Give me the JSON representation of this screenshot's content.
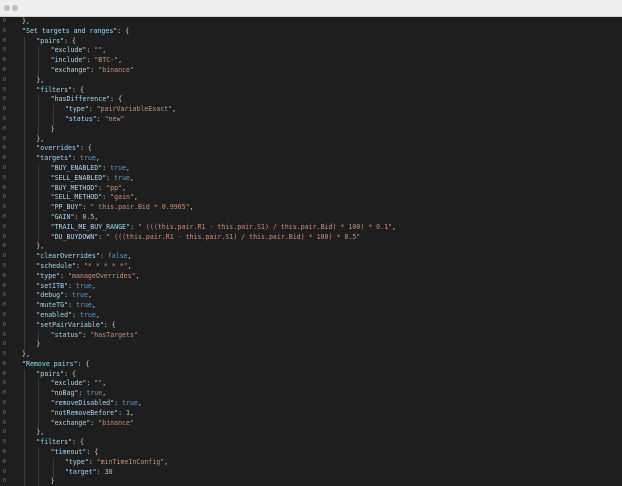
{
  "window": {
    "dots": [
      "close",
      "minimize"
    ]
  },
  "editor": {
    "lines": [
      {
        "no": "0",
        "indent": 1,
        "tokens": [
          {
            "t": "},",
            "c": "p"
          }
        ]
      },
      {
        "no": "0",
        "indent": 1,
        "tokens": [
          {
            "t": "\"Set targets and ranges\"",
            "c": "k"
          },
          {
            "t": ": {",
            "c": "p"
          }
        ]
      },
      {
        "no": "0",
        "indent": 2,
        "tokens": [
          {
            "t": "\"pairs\"",
            "c": "k"
          },
          {
            "t": ": {",
            "c": "p"
          }
        ]
      },
      {
        "no": "0",
        "indent": 3,
        "tokens": [
          {
            "t": "\"exclude\"",
            "c": "k"
          },
          {
            "t": ": ",
            "c": "p"
          },
          {
            "t": "\"\"",
            "c": "s"
          },
          {
            "t": ",",
            "c": "p"
          }
        ]
      },
      {
        "no": "0",
        "indent": 3,
        "tokens": [
          {
            "t": "\"include\"",
            "c": "k"
          },
          {
            "t": ": ",
            "c": "p"
          },
          {
            "t": "\"BTC-\"",
            "c": "s"
          },
          {
            "t": ",",
            "c": "p"
          }
        ]
      },
      {
        "no": "0",
        "indent": 3,
        "tokens": [
          {
            "t": "\"exchange\"",
            "c": "k"
          },
          {
            "t": ": ",
            "c": "p"
          },
          {
            "t": "\"binance\"",
            "c": "s"
          }
        ]
      },
      {
        "no": "0",
        "indent": 2,
        "tokens": [
          {
            "t": "},",
            "c": "p"
          }
        ]
      },
      {
        "no": "0",
        "indent": 2,
        "tokens": [
          {
            "t": "\"filters\"",
            "c": "k"
          },
          {
            "t": ": {",
            "c": "p"
          }
        ]
      },
      {
        "no": "0",
        "indent": 3,
        "tokens": [
          {
            "t": "\"hasDifference\"",
            "c": "k"
          },
          {
            "t": ": {",
            "c": "p"
          }
        ]
      },
      {
        "no": "0",
        "indent": 4,
        "tokens": [
          {
            "t": "\"type\"",
            "c": "k"
          },
          {
            "t": ": ",
            "c": "p"
          },
          {
            "t": "\"pairVariableExact\"",
            "c": "s"
          },
          {
            "t": ",",
            "c": "p"
          }
        ]
      },
      {
        "no": "0",
        "indent": 4,
        "tokens": [
          {
            "t": "\"status\"",
            "c": "k"
          },
          {
            "t": ": ",
            "c": "p"
          },
          {
            "t": "\"new\"",
            "c": "s"
          }
        ]
      },
      {
        "no": "0",
        "indent": 3,
        "tokens": [
          {
            "t": "}",
            "c": "p"
          }
        ]
      },
      {
        "no": "0",
        "indent": 2,
        "tokens": [
          {
            "t": "},",
            "c": "p"
          }
        ]
      },
      {
        "no": "0",
        "indent": 2,
        "tokens": [
          {
            "t": "\"overrides\"",
            "c": "k"
          },
          {
            "t": ": {",
            "c": "p"
          }
        ]
      },
      {
        "no": "0",
        "indent": 2,
        "tokens": [
          {
            "t": "\"targets\"",
            "c": "k"
          },
          {
            "t": ": ",
            "c": "p"
          },
          {
            "t": "true",
            "c": "b"
          },
          {
            "t": ",",
            "c": "p"
          }
        ]
      },
      {
        "no": "0",
        "indent": 3,
        "tokens": [
          {
            "t": "\"BUY_ENABLED\"",
            "c": "k"
          },
          {
            "t": ": ",
            "c": "p"
          },
          {
            "t": "true",
            "c": "b"
          },
          {
            "t": ",",
            "c": "p"
          }
        ]
      },
      {
        "no": "0",
        "indent": 3,
        "tokens": [
          {
            "t": "\"SELL_ENABLED\"",
            "c": "k"
          },
          {
            "t": ": ",
            "c": "p"
          },
          {
            "t": "true",
            "c": "b"
          },
          {
            "t": ",",
            "c": "p"
          }
        ]
      },
      {
        "no": "0",
        "indent": 3,
        "tokens": [
          {
            "t": "\"BUY_METHOD\"",
            "c": "k"
          },
          {
            "t": ": ",
            "c": "p"
          },
          {
            "t": "\"pp\"",
            "c": "s"
          },
          {
            "t": ",",
            "c": "p"
          }
        ]
      },
      {
        "no": "0",
        "indent": 3,
        "tokens": [
          {
            "t": "\"SELL_METHOD\"",
            "c": "k"
          },
          {
            "t": ": ",
            "c": "p"
          },
          {
            "t": "\"gain\"",
            "c": "s"
          },
          {
            "t": ",",
            "c": "p"
          }
        ]
      },
      {
        "no": "0",
        "indent": 3,
        "tokens": [
          {
            "t": "\"PP_BUY\"",
            "c": "k"
          },
          {
            "t": ": ",
            "c": "p"
          },
          {
            "t": "\" this.pair.Bid * 0.9965\"",
            "c": "s"
          },
          {
            "t": ",",
            "c": "p"
          }
        ]
      },
      {
        "no": "0",
        "indent": 3,
        "tokens": [
          {
            "t": "\"GAIN\"",
            "c": "k"
          },
          {
            "t": ": ",
            "c": "p"
          },
          {
            "t": "0.5",
            "c": "n"
          },
          {
            "t": ",",
            "c": "p"
          }
        ]
      },
      {
        "no": "0",
        "indent": 3,
        "tokens": [
          {
            "t": "\"TRAIL_ME_BUY_RANGE\"",
            "c": "k"
          },
          {
            "t": ": ",
            "c": "p"
          },
          {
            "t": "\" (((this.pair.R1 - this.pair.S1) / this.pair.Bid) * 100) * 0.1\"",
            "c": "s"
          },
          {
            "t": ",",
            "c": "p"
          }
        ]
      },
      {
        "no": "0",
        "indent": 3,
        "tokens": [
          {
            "t": "\"DU_BUYDOWN\"",
            "c": "k"
          },
          {
            "t": ": ",
            "c": "p"
          },
          {
            "t": "\" (((this.pair.R1 - this.pair.S1) / this.pair.Bid) * 100) * 0.5\"",
            "c": "s"
          }
        ]
      },
      {
        "no": "0",
        "indent": 2,
        "tokens": [
          {
            "t": "},",
            "c": "p"
          }
        ]
      },
      {
        "no": "0",
        "indent": 2,
        "tokens": [
          {
            "t": "\"clearOverrides\"",
            "c": "k"
          },
          {
            "t": ": ",
            "c": "p"
          },
          {
            "t": "false",
            "c": "b"
          },
          {
            "t": ",",
            "c": "p"
          }
        ]
      },
      {
        "no": "0",
        "indent": 2,
        "tokens": [
          {
            "t": "\"schedule\"",
            "c": "k"
          },
          {
            "t": ": ",
            "c": "p"
          },
          {
            "t": "\"* * * * *\"",
            "c": "s"
          },
          {
            "t": ",",
            "c": "p"
          }
        ]
      },
      {
        "no": "0",
        "indent": 2,
        "tokens": [
          {
            "t": "\"type\"",
            "c": "k"
          },
          {
            "t": ": ",
            "c": "p"
          },
          {
            "t": "\"manageOverrides\"",
            "c": "s"
          },
          {
            "t": ",",
            "c": "p"
          }
        ]
      },
      {
        "no": "0",
        "indent": 2,
        "tokens": [
          {
            "t": "\"setITB\"",
            "c": "k"
          },
          {
            "t": ": ",
            "c": "p"
          },
          {
            "t": "true",
            "c": "b"
          },
          {
            "t": ",",
            "c": "p"
          }
        ]
      },
      {
        "no": "0",
        "indent": 2,
        "tokens": [
          {
            "t": "\"debug\"",
            "c": "k"
          },
          {
            "t": ": ",
            "c": "p"
          },
          {
            "t": "true",
            "c": "b"
          },
          {
            "t": ",",
            "c": "p"
          }
        ]
      },
      {
        "no": "0",
        "indent": 2,
        "tokens": [
          {
            "t": "\"muteTG\"",
            "c": "k"
          },
          {
            "t": ": ",
            "c": "p"
          },
          {
            "t": "true",
            "c": "b"
          },
          {
            "t": ",",
            "c": "p"
          }
        ]
      },
      {
        "no": "0",
        "indent": 2,
        "tokens": [
          {
            "t": "\"enabled\"",
            "c": "k"
          },
          {
            "t": ": ",
            "c": "p"
          },
          {
            "t": "true",
            "c": "b"
          },
          {
            "t": ",",
            "c": "p"
          }
        ]
      },
      {
        "no": "0",
        "indent": 2,
        "tokens": [
          {
            "t": "\"setPairVariable\"",
            "c": "k"
          },
          {
            "t": ": {",
            "c": "p"
          }
        ]
      },
      {
        "no": "0",
        "indent": 3,
        "tokens": [
          {
            "t": "\"status\"",
            "c": "k"
          },
          {
            "t": ": ",
            "c": "p"
          },
          {
            "t": "\"hasTargets\"",
            "c": "s"
          }
        ]
      },
      {
        "no": "0",
        "indent": 2,
        "tokens": [
          {
            "t": "}",
            "c": "p"
          }
        ]
      },
      {
        "no": "0",
        "indent": 1,
        "tokens": [
          {
            "t": "},",
            "c": "p"
          }
        ]
      },
      {
        "no": "0",
        "indent": 1,
        "tokens": [
          {
            "t": "\"Remove pairs\"",
            "c": "k"
          },
          {
            "t": ": {",
            "c": "p"
          }
        ]
      },
      {
        "no": "0",
        "indent": 2,
        "tokens": [
          {
            "t": "\"pairs\"",
            "c": "k"
          },
          {
            "t": ": {",
            "c": "p"
          }
        ]
      },
      {
        "no": "0",
        "indent": 3,
        "tokens": [
          {
            "t": "\"exclude\"",
            "c": "k"
          },
          {
            "t": ": ",
            "c": "p"
          },
          {
            "t": "\"\"",
            "c": "s"
          },
          {
            "t": ",",
            "c": "p"
          }
        ]
      },
      {
        "no": "0",
        "indent": 3,
        "tokens": [
          {
            "t": "\"noBag\"",
            "c": "k"
          },
          {
            "t": ": ",
            "c": "p"
          },
          {
            "t": "true",
            "c": "b"
          },
          {
            "t": ",",
            "c": "p"
          }
        ]
      },
      {
        "no": "0",
        "indent": 3,
        "tokens": [
          {
            "t": "\"removeDisabled\"",
            "c": "k"
          },
          {
            "t": ": ",
            "c": "p"
          },
          {
            "t": "true",
            "c": "b"
          },
          {
            "t": ",",
            "c": "p"
          }
        ]
      },
      {
        "no": "0",
        "indent": 3,
        "tokens": [
          {
            "t": "\"notRemoveBefore\"",
            "c": "k"
          },
          {
            "t": ": ",
            "c": "p"
          },
          {
            "t": "1",
            "c": "n"
          },
          {
            "t": ",",
            "c": "p"
          }
        ]
      },
      {
        "no": "0",
        "indent": 3,
        "tokens": [
          {
            "t": "\"exchange\"",
            "c": "k"
          },
          {
            "t": ": ",
            "c": "p"
          },
          {
            "t": "\"binance\"",
            "c": "s"
          }
        ]
      },
      {
        "no": "0",
        "indent": 2,
        "tokens": [
          {
            "t": "},",
            "c": "p"
          }
        ]
      },
      {
        "no": "0",
        "indent": 2,
        "tokens": [
          {
            "t": "\"filters\"",
            "c": "k"
          },
          {
            "t": ": {",
            "c": "p"
          }
        ]
      },
      {
        "no": "0",
        "indent": 3,
        "tokens": [
          {
            "t": "\"timeout\"",
            "c": "k"
          },
          {
            "t": ": {",
            "c": "p"
          }
        ]
      },
      {
        "no": "0",
        "indent": 4,
        "tokens": [
          {
            "t": "\"type\"",
            "c": "k"
          },
          {
            "t": ": ",
            "c": "p"
          },
          {
            "t": "\"minTimeInConfig\"",
            "c": "s"
          },
          {
            "t": ",",
            "c": "p"
          }
        ]
      },
      {
        "no": "0",
        "indent": 4,
        "tokens": [
          {
            "t": "\"target\"",
            "c": "k"
          },
          {
            "t": ": ",
            "c": "p"
          },
          {
            "t": "30",
            "c": "n"
          }
        ]
      },
      {
        "no": "0",
        "indent": 3,
        "tokens": [
          {
            "t": "}",
            "c": "p"
          }
        ]
      }
    ]
  }
}
